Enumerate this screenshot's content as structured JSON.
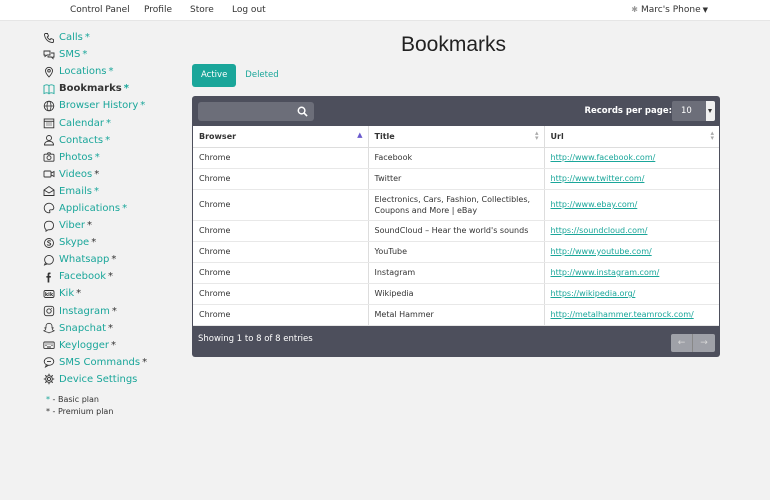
{
  "topbar": {
    "nav": [
      "Control Panel",
      "Profile",
      "Store",
      "Log out"
    ],
    "device": "Marc's Phone"
  },
  "sidebar": {
    "items": [
      {
        "label": "Calls",
        "star": "*",
        "plan": "basic",
        "icon": "phone-icon"
      },
      {
        "label": "SMS",
        "star": "*",
        "plan": "basic",
        "icon": "chat-bubbles-icon"
      },
      {
        "label": "Locations",
        "star": "*",
        "plan": "basic",
        "icon": "map-pin-icon"
      },
      {
        "label": "Bookmarks",
        "star": "*",
        "plan": "basic",
        "icon": "book-icon",
        "active": true
      },
      {
        "label": "Browser History",
        "star": "*",
        "plan": "basic",
        "icon": "globe-icon"
      },
      {
        "label": "Calendar",
        "star": "*",
        "plan": "basic",
        "icon": "calendar-icon"
      },
      {
        "label": "Contacts",
        "star": "*",
        "plan": "basic",
        "icon": "person-icon"
      },
      {
        "label": "Photos",
        "star": "*",
        "plan": "basic",
        "icon": "camera-icon"
      },
      {
        "label": "Videos",
        "star": "*",
        "plan": "premium",
        "icon": "video-icon"
      },
      {
        "label": "Emails",
        "star": "*",
        "plan": "basic",
        "icon": "envelope-icon"
      },
      {
        "label": "Applications",
        "star": "*",
        "plan": "basic",
        "icon": "palette-icon"
      },
      {
        "label": "Viber",
        "star": "*",
        "plan": "premium",
        "icon": "viber-icon"
      },
      {
        "label": "Skype",
        "star": "*",
        "plan": "premium",
        "icon": "skype-icon"
      },
      {
        "label": "Whatsapp",
        "star": "*",
        "plan": "premium",
        "icon": "whatsapp-icon"
      },
      {
        "label": "Facebook",
        "star": "*",
        "plan": "premium",
        "icon": "facebook-icon"
      },
      {
        "label": "Kik",
        "star": "*",
        "plan": "premium",
        "icon": "kik-icon"
      },
      {
        "label": "Instagram",
        "star": "*",
        "plan": "premium",
        "icon": "instagram-icon"
      },
      {
        "label": "Snapchat",
        "star": "*",
        "plan": "premium",
        "icon": "snapchat-icon"
      },
      {
        "label": "Keylogger",
        "star": "*",
        "plan": "premium",
        "icon": "keyboard-icon"
      },
      {
        "label": "SMS Commands",
        "star": "*",
        "plan": "premium",
        "icon": "message-cmd-icon"
      },
      {
        "label": "Device Settings",
        "star": "",
        "plan": "",
        "icon": "gear-icon"
      }
    ],
    "legend_basic": "* - Basic plan",
    "legend_premium": "* - Premium plan"
  },
  "main": {
    "title": "Bookmarks",
    "tabs": [
      {
        "label": "Active"
      },
      {
        "label": "Deleted"
      }
    ],
    "records_label": "Records per page:",
    "records_value": "10",
    "columns": [
      "Browser",
      "Title",
      "Url"
    ],
    "rows": [
      {
        "browser": "Chrome",
        "title": "Facebook",
        "url": "http://www.facebook.com/"
      },
      {
        "browser": "Chrome",
        "title": "Twitter",
        "url": "http://www.twitter.com/"
      },
      {
        "browser": "Chrome",
        "title": "Electronics, Cars, Fashion, Collectibles, Coupons and More | eBay",
        "url": "http://www.ebay.com/"
      },
      {
        "browser": "Chrome",
        "title": "SoundCloud – Hear the world's sounds",
        "url": "https://soundcloud.com/"
      },
      {
        "browser": "Chrome",
        "title": "YouTube",
        "url": "http://www.youtube.com/"
      },
      {
        "browser": "Chrome",
        "title": "Instagram",
        "url": "http://www.instagram.com/"
      },
      {
        "browser": "Chrome",
        "title": "Wikipedia",
        "url": "https://wikipedia.org/"
      },
      {
        "browser": "Chrome",
        "title": "Metal Hammer",
        "url": "http://metalhammer.teamrock.com/"
      }
    ],
    "footer": "Showing 1 to 8 of 8 entries",
    "pager_prev": "←",
    "pager_next": "→"
  },
  "colors": {
    "accent": "#1aa69a",
    "panel": "#4d4f5c"
  }
}
